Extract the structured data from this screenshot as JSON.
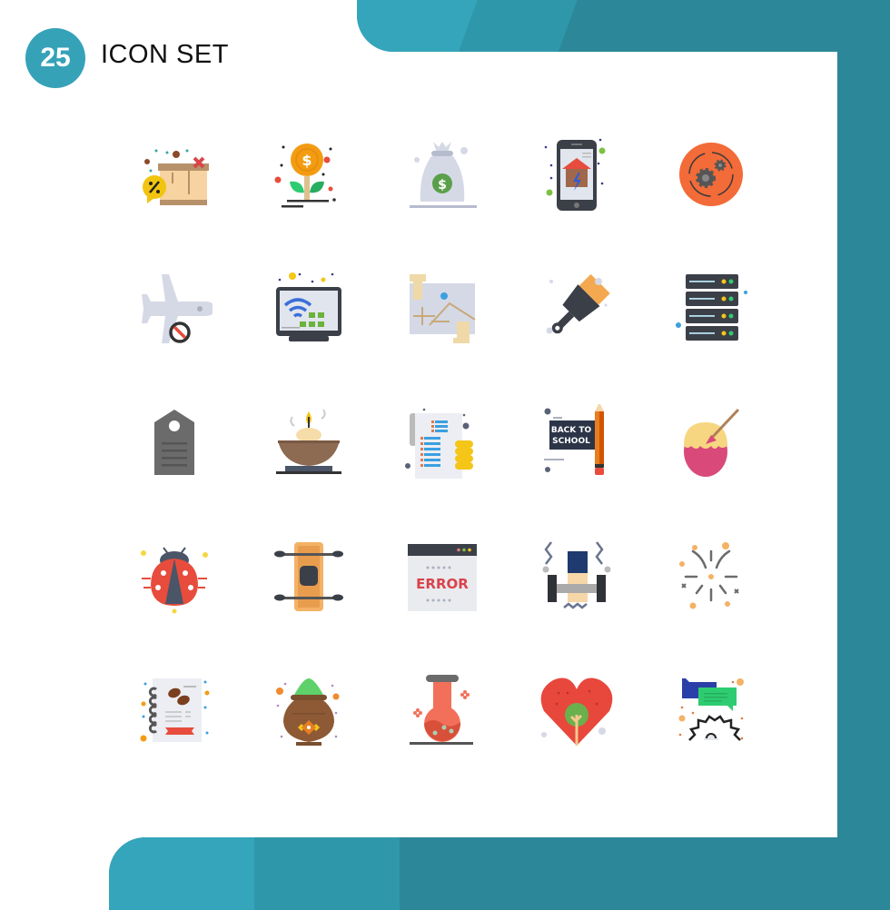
{
  "header": {
    "badge_number": "25",
    "title": "ICON SET"
  },
  "colors": {
    "teal_light": "#35a5bb",
    "teal_mid": "#2f97aa",
    "teal_dark": "#2c8798",
    "badge": "#35a2b8"
  },
  "icons": [
    {
      "row": 1,
      "col": 1,
      "name": "gift-box-discount-icon"
    },
    {
      "row": 1,
      "col": 2,
      "name": "money-growth-plant-icon"
    },
    {
      "row": 1,
      "col": 3,
      "name": "money-bag-icon"
    },
    {
      "row": 1,
      "col": 4,
      "name": "smart-home-phone-icon"
    },
    {
      "row": 1,
      "col": 5,
      "name": "gear-process-icon"
    },
    {
      "row": 2,
      "col": 1,
      "name": "no-flight-icon"
    },
    {
      "row": 2,
      "col": 2,
      "name": "wifi-monitor-icon"
    },
    {
      "row": 2,
      "col": 3,
      "name": "map-location-icon"
    },
    {
      "row": 2,
      "col": 4,
      "name": "paint-brush-icon"
    },
    {
      "row": 2,
      "col": 5,
      "name": "server-rack-icon"
    },
    {
      "row": 3,
      "col": 1,
      "name": "price-tag-icon"
    },
    {
      "row": 3,
      "col": 2,
      "name": "diya-lamp-icon"
    },
    {
      "row": 3,
      "col": 3,
      "name": "invoice-coins-icon"
    },
    {
      "row": 3,
      "col": 4,
      "name": "back-to-school-icon",
      "label": "BACK TO SCHOOL"
    },
    {
      "row": 3,
      "col": 5,
      "name": "easter-egg-paint-icon"
    },
    {
      "row": 4,
      "col": 1,
      "name": "ladybug-icon"
    },
    {
      "row": 4,
      "col": 2,
      "name": "kayak-icon"
    },
    {
      "row": 4,
      "col": 3,
      "name": "browser-error-icon",
      "label": "ERROR"
    },
    {
      "row": 4,
      "col": 4,
      "name": "dumbbell-workout-icon"
    },
    {
      "row": 4,
      "col": 5,
      "name": "fireworks-icon"
    },
    {
      "row": 5,
      "col": 1,
      "name": "coffee-menu-icon"
    },
    {
      "row": 5,
      "col": 2,
      "name": "holi-color-pot-icon"
    },
    {
      "row": 5,
      "col": 3,
      "name": "chemistry-flask-icon"
    },
    {
      "row": 5,
      "col": 4,
      "name": "eco-heart-tree-icon"
    },
    {
      "row": 5,
      "col": 5,
      "name": "chat-settings-icon"
    }
  ]
}
